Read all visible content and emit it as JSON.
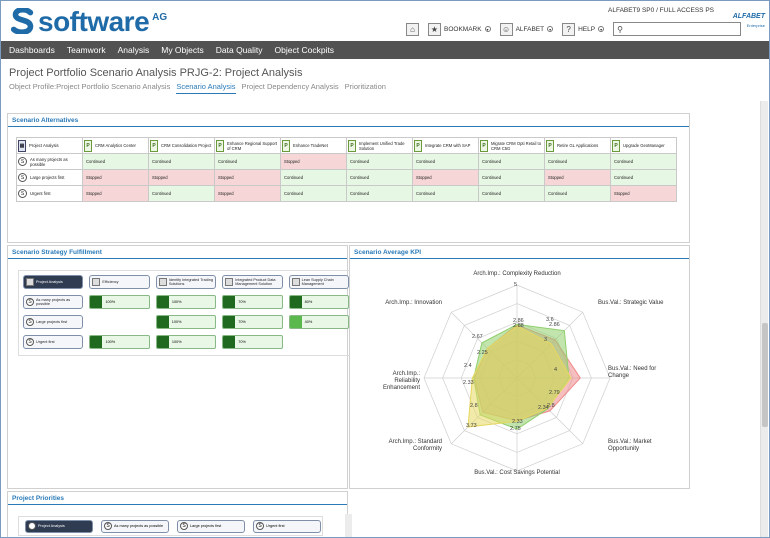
{
  "header": {
    "brand_name": "software",
    "brand_suffix": "AG",
    "session_info": "ALFABET9 SP0 / FULL ACCESS PS",
    "product_name": "ALFABET",
    "product_tag": "Enterprise",
    "bookmark_label": "BOOKMARK",
    "user_label": "ALFABET",
    "help_label": "HELP",
    "search_placeholder": ""
  },
  "nav": {
    "items": [
      "Dashboards",
      "Teamwork",
      "Analysis",
      "My Objects",
      "Data Quality",
      "Object Cockpits"
    ]
  },
  "page": {
    "title": "Project Portfolio Scenario Analysis PRJG-2: Project Analysis",
    "tabs": [
      "Object Profile:Project Portfolio Scenario Analysis",
      "Scenario Analysis",
      "Project Dependency Analysis",
      "Prioritization"
    ],
    "active_tab": "Scenario Analysis"
  },
  "scenario_alternatives": {
    "title": "Scenario Alternatives",
    "corner_label": "Project Analysis",
    "columns": [
      "CRM Analytics Center",
      "CRM Consolidation Project",
      "Enhance Regional Support of CRM",
      "Enhance TradeNet",
      "Implement Unified Trade Solution",
      "Integrate CRM with SAP",
      "Migrate CRM Opti Retail to CRM C5G",
      "Retire GL Applications",
      "Upgrade GeoManager"
    ],
    "rows": [
      {
        "label": "As many projects as possible",
        "cells": [
          "Continued",
          "Continued",
          "Continued",
          "Stopped",
          "Continued",
          "Continued",
          "Continued",
          "Continued",
          "Continued"
        ]
      },
      {
        "label": "Large projects first",
        "cells": [
          "Stopped",
          "Stopped",
          "Stopped",
          "Continued",
          "Continued",
          "Stopped",
          "Continued",
          "Stopped",
          "Continued"
        ]
      },
      {
        "label": "Urgent first",
        "cells": [
          "Stopped",
          "Continued",
          "Stopped",
          "Continued",
          "Continued",
          "Continued",
          "Continued",
          "Continued",
          "Stopped"
        ]
      }
    ]
  },
  "strategy_fulfillment": {
    "title": "Scenario Strategy Fulfillment",
    "corner_label": "Project Analysis",
    "columns": [
      "Efficiency",
      "Identify Integrated Trading Solutions",
      "Integrated Product Data Management Solution",
      "Lean Supply Chain Management"
    ],
    "rows": [
      {
        "label": "As many projects as possible",
        "cells": [
          "100%",
          "100%",
          "70%",
          "80%"
        ]
      },
      {
        "label": "Large projects first",
        "cells": [
          "",
          "100%",
          "70%",
          "40%"
        ]
      },
      {
        "label": "Urgent first",
        "cells": [
          "100%",
          "100%",
          "70%",
          ""
        ]
      }
    ]
  },
  "kpi": {
    "title": "Scenario Average KPI",
    "axes": [
      "Arch.Imp.: Complexity Reduction",
      "Bus.Val.: Strategic Value",
      "Bus.Val.: Need for Change",
      "Bus.Val.: Market Opportunity",
      "Bus.Val.: Cost Savings Potential",
      "Arch.Imp.: Standard Conformity",
      "Arch.Imp.: Reliability Enhancement",
      "Arch.Imp.: Innovation"
    ],
    "value_labels": [
      "5",
      "2.86",
      "2.88",
      "3.6",
      "2.86",
      "3",
      "4",
      "2.79",
      "2.8",
      "2.34",
      "2.33",
      "2.75",
      "3.73",
      "2.8",
      "2.4",
      "2.33",
      "2.67",
      "2.25"
    ],
    "colors": {
      "green": "#8fcf6b",
      "red": "#ee8a8a",
      "yellow": "#e6d860",
      "grid": "#cfcfcf"
    }
  },
  "priorities": {
    "title": "Project Priorities",
    "items": [
      "Project Analysis",
      "As many projects as possible",
      "Large projects first",
      "Urgent first"
    ]
  }
}
